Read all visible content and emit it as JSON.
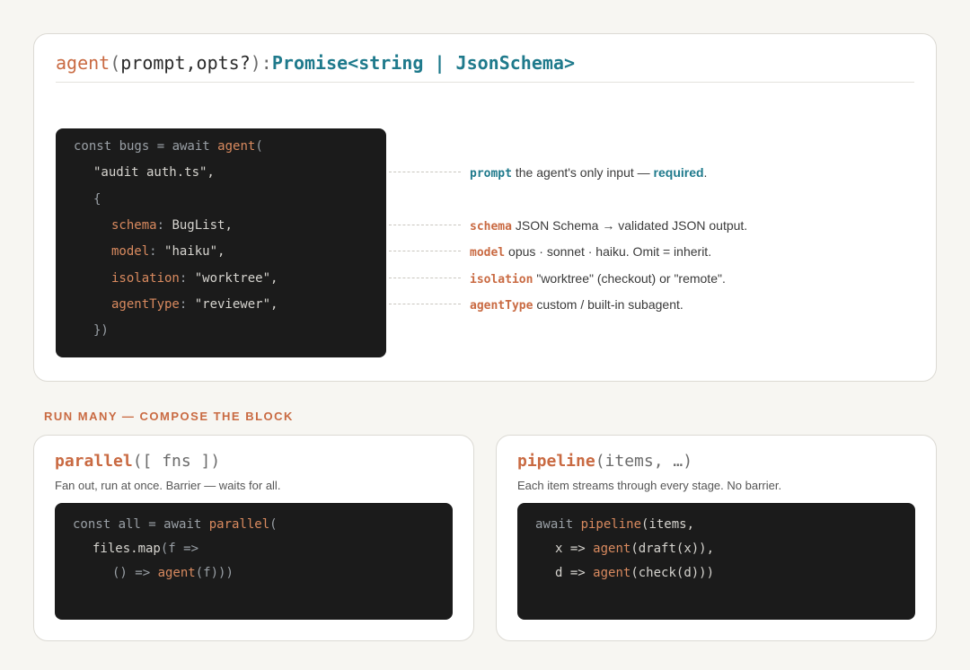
{
  "signature": {
    "fn": "agent",
    "open": "(",
    "params": "prompt,opts?",
    "close": "):",
    "ret": "Promise<string | JsonSchema>"
  },
  "main_code": {
    "l1": {
      "kw1": "const bugs = ",
      "kw2": "await ",
      "fn": "agent",
      "p": "("
    },
    "l2": {
      "text": "\"audit auth.ts\","
    },
    "l3": {
      "text": "{"
    },
    "l4": {
      "key": "schema",
      "sep": ": ",
      "val": "BugList,"
    },
    "l5": {
      "key": "model",
      "sep": ": ",
      "val": "\"haiku\","
    },
    "l6": {
      "key": "isolation",
      "sep": ": ",
      "val": "\"worktree\","
    },
    "l7": {
      "key": "agentType",
      "sep": ": ",
      "val": "\"reviewer\","
    },
    "l8": {
      "text": "})"
    }
  },
  "annotations": [
    {
      "name": "prompt",
      "desc": "the agent's only input — ",
      "emph": "required",
      "tail": "."
    },
    {
      "name": "schema",
      "desc": "JSON Schema → validated JSON output."
    },
    {
      "name": "model",
      "desc": "opus · sonnet · haiku. Omit = inherit."
    },
    {
      "name": "isolation",
      "desc": "\"worktree\" (checkout) or \"remote\"."
    },
    {
      "name": "agentType",
      "desc": "custom / built-in subagent."
    }
  ],
  "section_label": "RUN MANY — COMPOSE THE BLOCK",
  "parallel": {
    "fname": "parallel",
    "args": "([ fns ])",
    "desc": "Fan out, run at once. Barrier — waits for all.",
    "l1": {
      "kw1": "const all = ",
      "kw2": "await ",
      "fn": "parallel",
      "p": "("
    },
    "l2": {
      "a": "files.map",
      "b": "(f =>"
    },
    "l3": {
      "a": "() => ",
      "fn": "agent",
      "b": "(f)))"
    }
  },
  "pipeline": {
    "fname": "pipeline",
    "args": "(items, …)",
    "desc": "Each item streams through every stage. No barrier.",
    "l1": {
      "kw": "await ",
      "fn": "pipeline",
      "b": "(items,"
    },
    "l2": {
      "a": "x => ",
      "fn": "agent",
      "b": "(draft(x)),"
    },
    "l3": {
      "a": "d => ",
      "fn": "agent",
      "b": "(check(d)))"
    }
  }
}
